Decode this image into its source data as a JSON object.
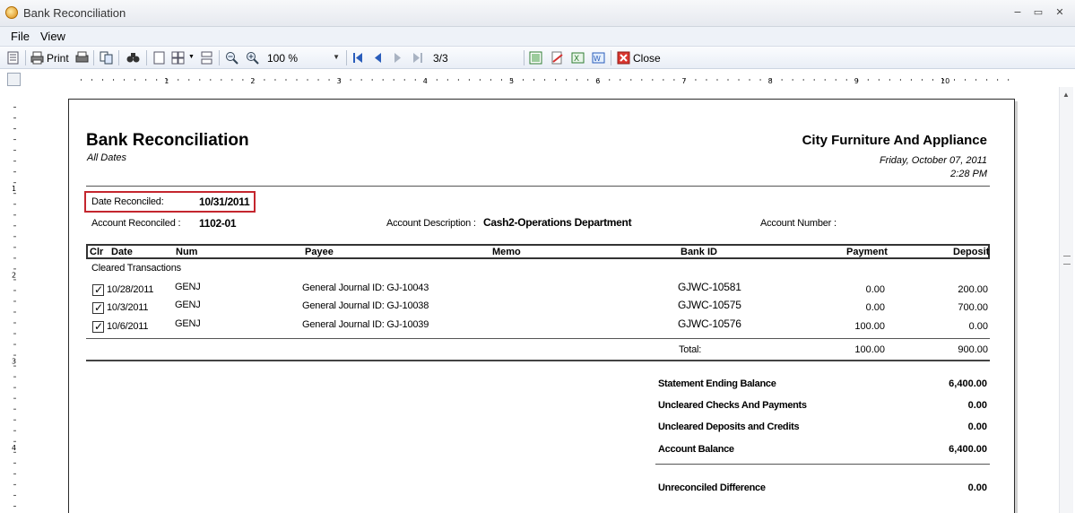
{
  "window": {
    "title": "Bank Reconciliation",
    "minimize": "−",
    "maximize": "▭",
    "close": "✕"
  },
  "menu": {
    "file": "File",
    "view": "View"
  },
  "toolbar": {
    "print_label": "Print",
    "zoom_value": "100 %",
    "page_indicator": "3/3",
    "close_label": "Close"
  },
  "ruler": {
    "ticks": [
      "1",
      "2",
      "3",
      "4",
      "5",
      "6",
      "7",
      "8",
      "9",
      "10"
    ],
    "left_ticks": [
      "1",
      "2",
      "3",
      "4"
    ]
  },
  "report": {
    "title": "Bank Reconciliation",
    "subtitle": "All Dates",
    "company": "City Furniture And Appliance",
    "print_date": "Friday, October 07, 2011",
    "print_time": "2:28 PM",
    "date_reconciled_label": "Date Reconciled:",
    "date_reconciled_value": "10/31/2011",
    "account_reconciled_label": "Account Reconciled :",
    "account_reconciled_value": "1102-01",
    "account_description_label": "Account Description :",
    "account_description_value": "Cash2-Operations Department",
    "account_number_label": "Account Number :",
    "account_number_value": "",
    "columns": {
      "clr": "Clr",
      "date": "Date",
      "num": "Num",
      "payee": "Payee",
      "memo": "Memo",
      "bank_id": "Bank ID",
      "payment": "Payment",
      "deposit": "Deposit"
    },
    "section_label": "Cleared Transactions",
    "rows": [
      {
        "cleared": true,
        "date": "10/28/2011",
        "num": "GENJ",
        "payee": "General Journal ID: GJ-10043",
        "memo": "",
        "bank_id": "GJWC-10581",
        "payment": "0.00",
        "deposit": "200.00"
      },
      {
        "cleared": true,
        "date": "10/3/2011",
        "num": "GENJ",
        "payee": "General Journal ID: GJ-10038",
        "memo": "",
        "bank_id": "GJWC-10575",
        "payment": "0.00",
        "deposit": "700.00"
      },
      {
        "cleared": true,
        "date": "10/6/2011",
        "num": "GENJ",
        "payee": "General Journal ID: GJ-10039",
        "memo": "",
        "bank_id": "GJWC-10576",
        "payment": "100.00",
        "deposit": "0.00"
      }
    ],
    "total_label": "Total:",
    "total_payment": "100.00",
    "total_deposit": "900.00",
    "summary": [
      {
        "label": "Statement Ending Balance",
        "value": "6,400.00"
      },
      {
        "label": "Uncleared Checks And Payments",
        "value": "0.00"
      },
      {
        "label": "Uncleared Deposits and Credits",
        "value": "0.00"
      },
      {
        "label": "Account Balance",
        "value": "6,400.00"
      }
    ],
    "difference_label": "Unreconciled Difference",
    "difference_value": "0.00"
  },
  "colors": {
    "highlight_box": "#c4262e",
    "accent": "#2a5dbb"
  }
}
